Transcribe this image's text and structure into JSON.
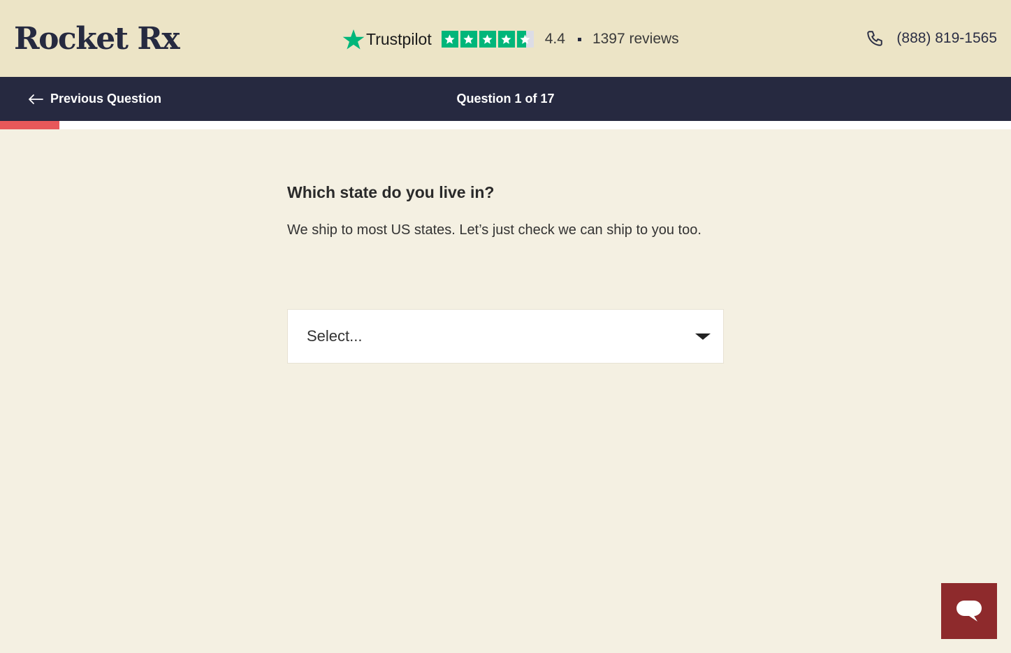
{
  "header": {
    "logo_text": "Rocket Rx",
    "trustpilot": {
      "brand": "Trustpilot",
      "rating": "4.4",
      "rating_value": 4.4,
      "max_stars": 5,
      "reviews": "1397 reviews"
    },
    "phone": "(888) 819-1565",
    "colors": {
      "background": "#ece4c6",
      "brand_dark": "#262a40",
      "trust_green": "#00b67a"
    }
  },
  "nav": {
    "previous_label": "Previous Question",
    "question_counter": "Question 1 of 17",
    "background": "#262940"
  },
  "progress": {
    "fraction": 0.059,
    "fill_color": "#e8585a"
  },
  "main": {
    "question": "Which state do you live in?",
    "description": "We ship to most US states. Let’s just check we can ship to you too.",
    "state_select": {
      "placeholder": "Select..."
    }
  },
  "chat": {
    "icon": "chat-bubble-icon",
    "color": "#8e2a2c"
  }
}
